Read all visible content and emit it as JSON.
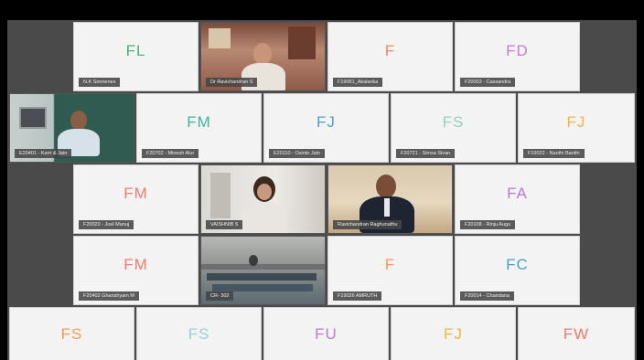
{
  "colors": {
    "gallery_bg": "#4a4a4a",
    "tile_bg": "#f3f3f3",
    "name_bg": "#464646"
  },
  "participants": [
    {
      "id": "fl",
      "initials": "FL",
      "name": "N.K Sonnenes",
      "color": "#4caf7a",
      "video": false
    },
    {
      "id": "ravi",
      "initials": "",
      "name": "Dr Ravichandran S",
      "color": "",
      "video": true
    },
    {
      "id": "f1",
      "initials": "F",
      "name": "F19001_Akalanka",
      "color": "#f08a5d",
      "video": false
    },
    {
      "id": "fd",
      "initials": "FD",
      "name": "F20003 - Cassandra",
      "color": "#c77dd1",
      "video": false
    },
    {
      "id": "kari",
      "initials": "",
      "name": "E20401 - Karri & Jain",
      "color": "",
      "video": true
    },
    {
      "id": "fm1",
      "initials": "FM",
      "name": "F20702 - Minesh Alur",
      "color": "#3fb59c",
      "video": false
    },
    {
      "id": "fj1",
      "initials": "FJ",
      "name": "E20110 - Osinto Jain",
      "color": "#4a9fd6",
      "video": false
    },
    {
      "id": "fs1",
      "initials": "FS",
      "name": "F20721 - Simsa Sivan",
      "color": "#8fd3b9",
      "video": false
    },
    {
      "id": "fj2",
      "initials": "FJ",
      "name": "F19022 - Nanthi Banthi",
      "color": "#f2b63d",
      "video": false
    },
    {
      "id": "fm2",
      "initials": "FM",
      "name": "F20020 - Joel Manuj",
      "color": "#f07b6b",
      "video": false
    },
    {
      "id": "vais",
      "initials": "",
      "name": "VAISHNIB S",
      "color": "",
      "video": true
    },
    {
      "id": "ravg",
      "initials": "",
      "name": "Ravichandran Raghunathu",
      "color": "",
      "video": true
    },
    {
      "id": "fa",
      "initials": "FA",
      "name": "F20108 - Rinju Augu",
      "color": "#b67dd4",
      "video": false
    },
    {
      "id": "fm3",
      "initials": "FM",
      "name": "F20402 Ghanshyam M",
      "color": "#f07b6b",
      "video": false
    },
    {
      "id": "cr",
      "initials": "",
      "name": "CR- 302",
      "color": "",
      "video": true
    },
    {
      "id": "f2",
      "initials": "F",
      "name": "F19026 AMRUTH",
      "color": "#f59a4f",
      "video": false
    },
    {
      "id": "fc",
      "initials": "FC",
      "name": "F20014 - Chandana",
      "color": "#4a9fd6",
      "video": false
    },
    {
      "id": "fs2",
      "initials": "FS",
      "name": "",
      "color": "#f59a4f",
      "video": false
    },
    {
      "id": "fs3",
      "initials": "FS",
      "name": "",
      "color": "#9ccfd8",
      "video": false
    },
    {
      "id": "fu",
      "initials": "FU",
      "name": "",
      "color": "#b67dd4",
      "video": false
    },
    {
      "id": "fj3",
      "initials": "FJ",
      "name": "",
      "color": "#f2b63d",
      "video": false
    },
    {
      "id": "fw",
      "initials": "FW",
      "name": "",
      "color": "#f07b6b",
      "video": false
    }
  ]
}
